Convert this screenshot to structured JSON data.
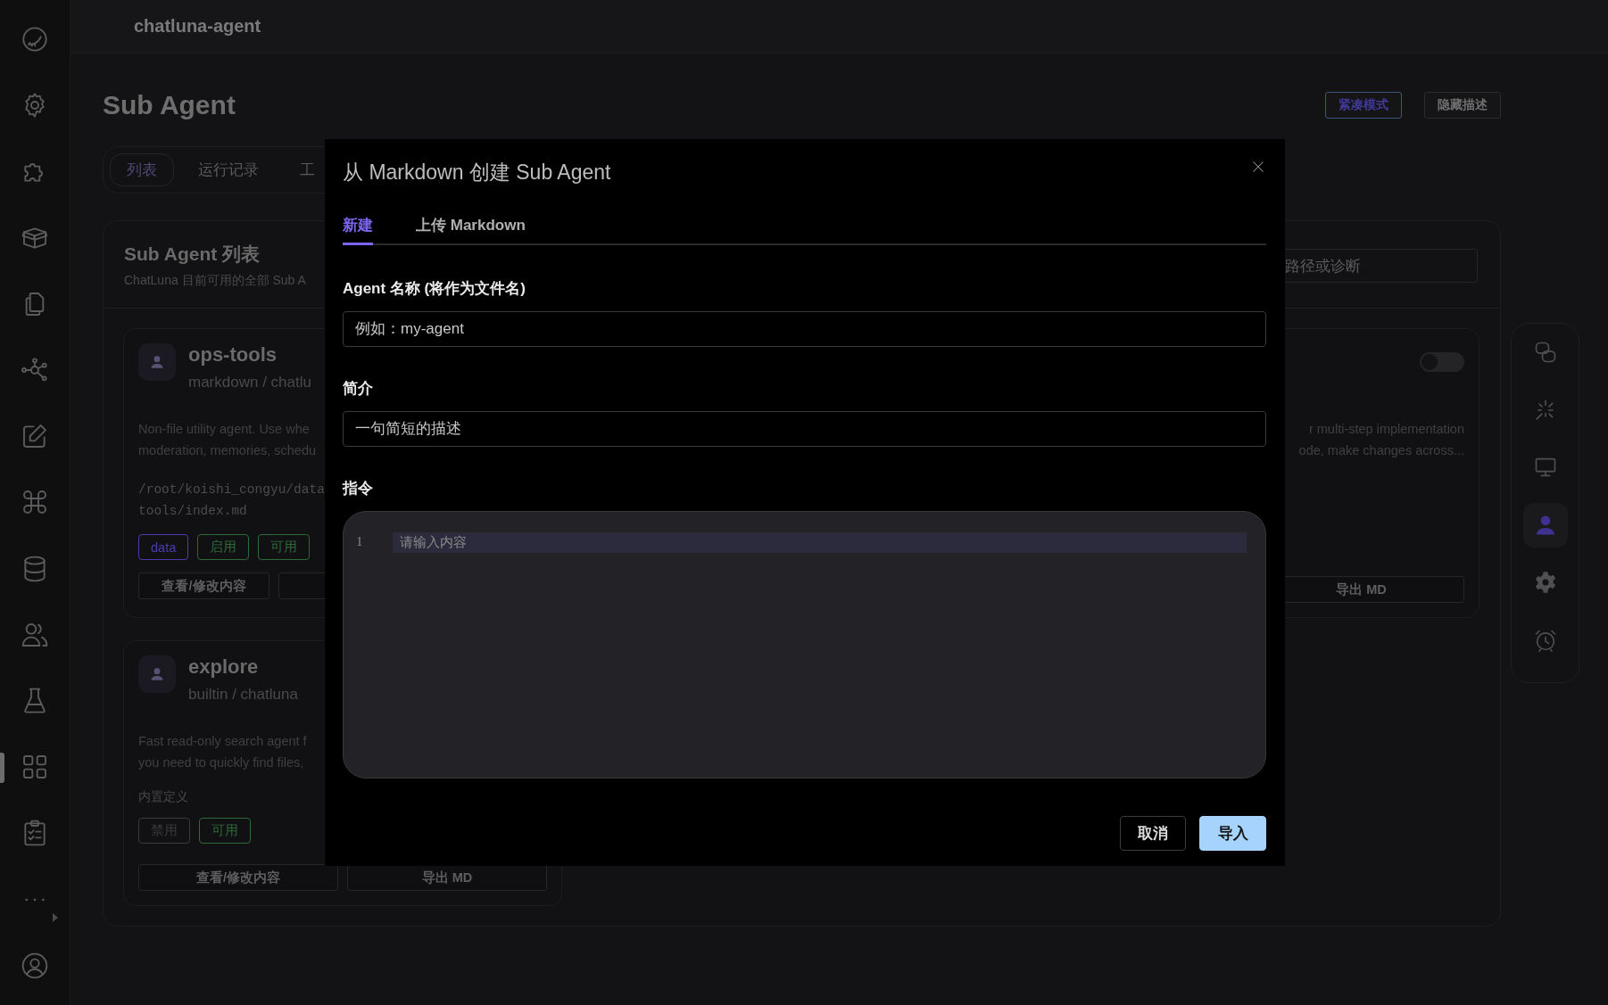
{
  "sidebar": {
    "items": [
      {
        "selected": false
      },
      {
        "selected": false
      },
      {
        "selected": false
      },
      {
        "selected": false
      },
      {
        "selected": false
      },
      {
        "selected": false
      },
      {
        "selected": false
      },
      {
        "selected": false
      },
      {
        "selected": false
      },
      {
        "selected": false
      },
      {
        "selected": false
      },
      {
        "selected": true
      },
      {
        "selected": false
      },
      {
        "selected": false
      },
      {
        "selected": false
      }
    ]
  },
  "header": {
    "title": "chatluna-agent"
  },
  "page": {
    "title": "Sub Agent",
    "actions": [
      {
        "label": "紧凑模式",
        "selected": true
      },
      {
        "label": "隐藏描述",
        "selected": false
      }
    ]
  },
  "tabs": [
    {
      "label": "列表",
      "selected": true
    },
    {
      "label": "运行记录",
      "selected": false
    },
    {
      "label": "工",
      "selected": false
    }
  ],
  "list_panel": {
    "title": "Sub Agent 列表",
    "subtitle": "ChatLuna 目前可用的全部 Sub A",
    "search": {
      "placeholder": "路径或诊断"
    }
  },
  "agents": [
    {
      "name": "ops-tools",
      "source": "markdown / chatlu",
      "description": [
        "Non-file utility agent. Use whe",
        "moderation, memories, schedu"
      ],
      "path": [
        "/root/koishi_congyu/data",
        "tools/index.md"
      ],
      "tags": [
        {
          "label": "data",
          "color": "#4a3cb0"
        },
        {
          "label": "启用",
          "color": "#2e6b3a"
        },
        {
          "label": "可用",
          "color": "#2e6b3a"
        }
      ],
      "buttons": [
        "查看/修改内容"
      ],
      "cut_button": true
    },
    {
      "name": "explore",
      "source": "builtin / chatluna",
      "description": [
        "Fast read-only search agent f",
        "you need to quickly find files,"
      ],
      "note": "内置定义",
      "tags": [
        {
          "label": "禁用",
          "color": "#3a3a3a"
        },
        {
          "label": "可用",
          "color": "#2e6b3a"
        }
      ],
      "buttons": [
        "查看/修改内容",
        "导出 MD"
      ],
      "cut_button": false
    }
  ],
  "right_card": {
    "on": false,
    "description": [
      "r multi-step implementation",
      "ode, make changes across..."
    ],
    "buttons": [
      "导出 MD"
    ]
  },
  "dock": {
    "items": [
      {
        "selected": false
      },
      {
        "selected": false
      },
      {
        "selected": false
      },
      {
        "selected": true
      },
      {
        "selected": false
      },
      {
        "selected": false
      }
    ]
  },
  "modal": {
    "title": "从 Markdown 创建 Sub Agent",
    "tabs": [
      {
        "label": "新建",
        "selected": true
      },
      {
        "label": "上传 Markdown",
        "selected": false
      }
    ],
    "fields": [
      {
        "kind": "input",
        "label": "Agent 名称 (将作为文件名)",
        "placeholder": "例如：my-agent"
      },
      {
        "kind": "input",
        "label": "简介",
        "placeholder": "一句简短的描述"
      },
      {
        "kind": "editor",
        "label": "指令",
        "line_number": "1",
        "placeholder": "请输入内容"
      }
    ],
    "buttons": [
      {
        "kind": "secondary",
        "label": "取消"
      },
      {
        "kind": "primary",
        "label": "导入"
      }
    ]
  }
}
